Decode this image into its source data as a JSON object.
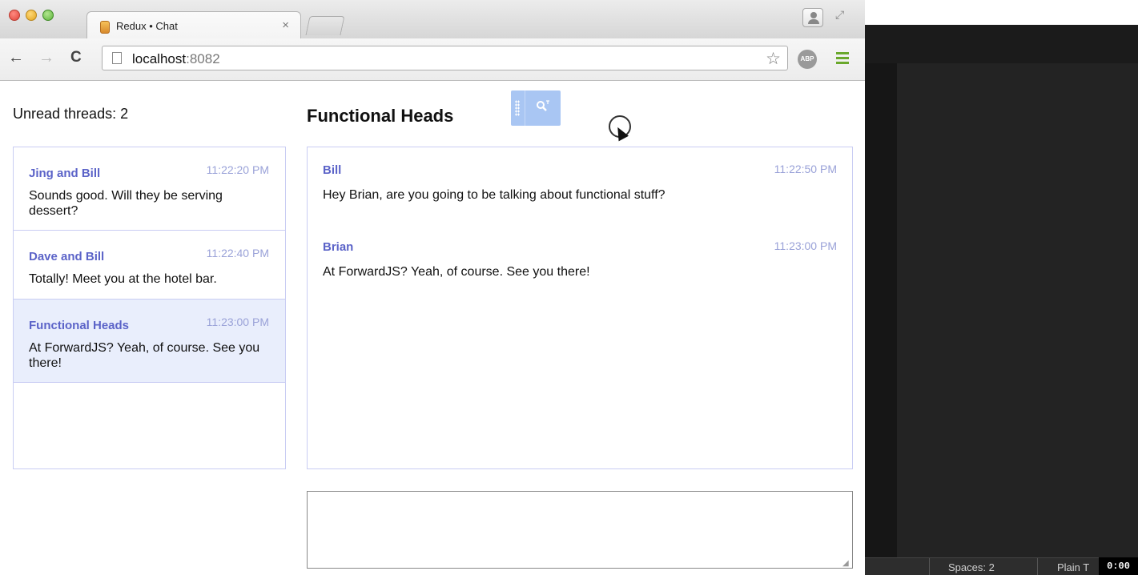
{
  "browser": {
    "tab_title": "Redux • Chat",
    "tab_close": "×",
    "url_host": "localhost",
    "url_port": ":8082",
    "icons": {
      "back": "←",
      "forward": "→",
      "reload": "C",
      "star": "☆",
      "abp": "ABP",
      "fullscreen": "⤢"
    }
  },
  "sidebar": {
    "unread_label": "Unread threads: 2",
    "threads": [
      {
        "name": "Jing and Bill",
        "time": "11:22:20 PM",
        "preview": "Sounds good. Will they be serving dessert?",
        "active": false
      },
      {
        "name": "Dave and Bill",
        "time": "11:22:40 PM",
        "preview": "Totally! Meet you at the hotel bar.",
        "active": false
      },
      {
        "name": "Functional Heads",
        "time": "11:23:00 PM",
        "preview": "At ForwardJS? Yeah, of course. See you there!",
        "active": true
      }
    ]
  },
  "chat": {
    "title": "Functional Heads",
    "messages": [
      {
        "author": "Bill",
        "time": "11:22:50 PM",
        "text": "Hey Brian, are you going to be talking about functional stuff?"
      },
      {
        "author": "Brian",
        "time": "11:23:00 PM",
        "text": "At ForwardJS? Yeah, of course. See you there!"
      }
    ],
    "composer_value": ""
  },
  "editor": {
    "status_spaces": "Spaces: 2",
    "status_syntax": "Plain T",
    "timer": "0:00"
  },
  "colors": {
    "accent": "#5b63c8",
    "timestamp": "#9aa2d8",
    "border": "#c9cdf3",
    "active_thread_bg": "#e9eefc"
  }
}
